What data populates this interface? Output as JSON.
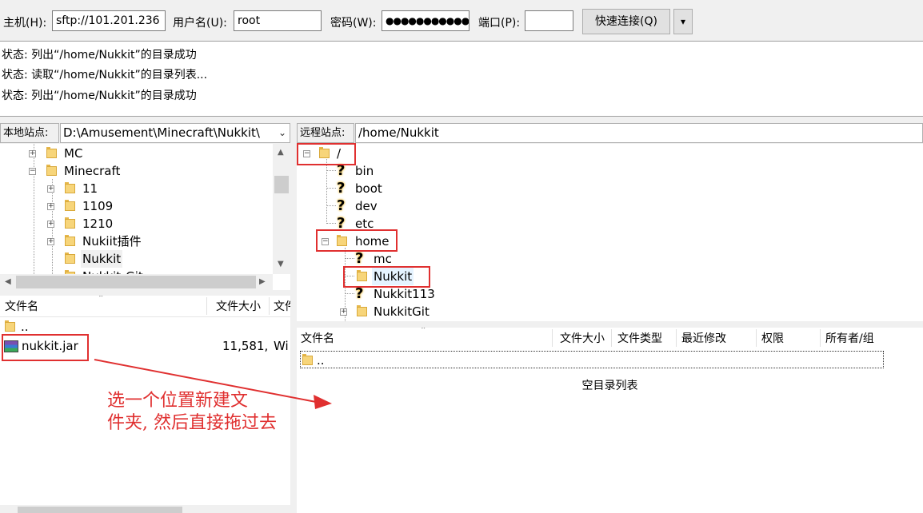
{
  "quickconnect": {
    "host_label": "主机(H):",
    "host_value": "sftp://101.201.236",
    "user_label": "用户名(U):",
    "user_value": "root",
    "pass_label": "密码(W):",
    "pass_value": "●●●●●●●●●●●",
    "port_label": "端口(P):",
    "port_value": "",
    "connect_label": "快速连接(Q)",
    "dropdown_glyph": "▾"
  },
  "log": [
    "状态:  列出“/home/Nukkit”的目录成功",
    "状态:  读取“/home/Nukkit”的目录列表...",
    "状态:  列出“/home/Nukkit”的目录成功"
  ],
  "local": {
    "site_label": "本地站点:",
    "site_path": "D:\\Amusement\\Minecraft\\Nukkit\\",
    "tree": [
      "MC",
      "Minecraft",
      "11",
      "1109",
      "1210",
      "Nukiit插件",
      "Nukkit",
      "Nukkit-Git"
    ],
    "columns": [
      "文件名",
      "文件大小",
      "文件"
    ],
    "files": [
      {
        "name": "..",
        "size": "",
        "type": ""
      },
      {
        "name": "nukkit.jar",
        "size": "11,581,",
        "type": "Wi"
      }
    ]
  },
  "remote": {
    "site_label": "远程站点:",
    "site_path": "/home/Nukkit",
    "tree": [
      "/",
      "bin",
      "boot",
      "dev",
      "etc",
      "home",
      "mc",
      "Nukkit",
      "Nukkit113",
      "NukkitGit"
    ],
    "columns": [
      "文件名",
      "文件大小",
      "文件类型",
      "最近修改",
      "权限",
      "所有者/组"
    ],
    "files": [
      {
        "name": ".."
      }
    ],
    "empty_text": "空目录列表"
  },
  "annotation": {
    "line1": "选一个位置新建文",
    "line2": "件夹, 然后直接拖过去",
    "color": "#e03030"
  }
}
